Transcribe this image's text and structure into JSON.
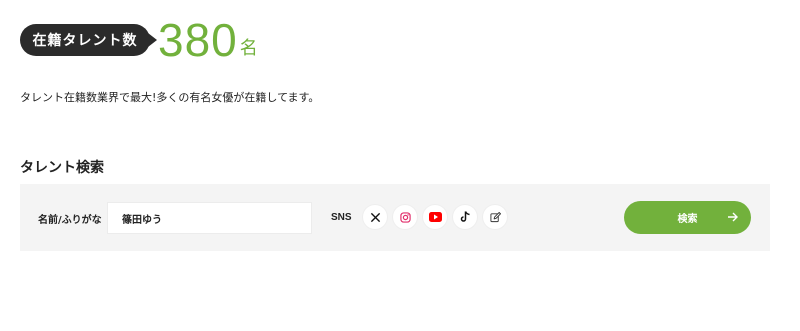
{
  "talent_count": {
    "badge_label": "在籍タレント数",
    "number": "380",
    "unit": "名",
    "accent_color": "#72b13c"
  },
  "intro_text": "タレント在籍数業界で最大!多くの有名女優が在籍してます。",
  "search": {
    "heading": "タレント検索",
    "name_label": "名前/ふりがな",
    "name_value": "篠田ゆう",
    "sns_label": "SNS",
    "sns_icons": [
      "x-icon",
      "instagram-icon",
      "youtube-icon",
      "tiktok-icon",
      "blog-edit-icon"
    ],
    "button_label": "検索",
    "button_icon": "arrow-right-icon"
  }
}
